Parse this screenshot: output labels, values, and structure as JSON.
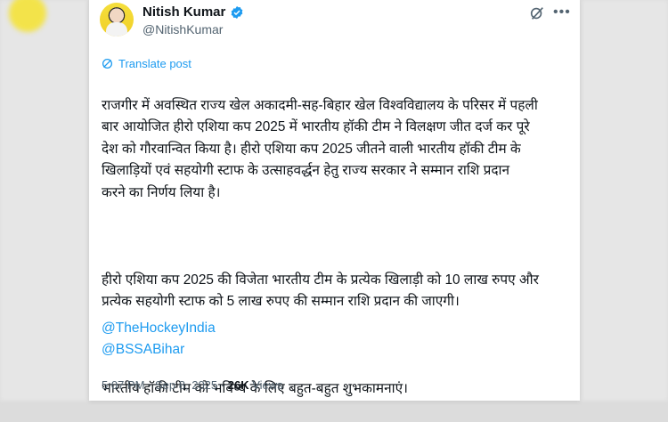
{
  "author": {
    "name": "Nitish Kumar",
    "handle": "@NitishKumar"
  },
  "translate_label": "Translate post",
  "post": {
    "paragraph1": "राजगीर में अवस्थित राज्य खेल अकादमी-सह-बिहार खेल विश्वविद्यालय के परिसर में पहली\nबार आयोजित हीरो एशिया कप 2025 में भारतीय हॉकी टीम ने विलक्षण जीत दर्ज कर पूरे\nदेश को गौरवान्वित किया है। हीरो एशिया कप 2025 जीतने वाली भारतीय हॉकी टीम के\nखिलाड़ियों एवं सहयोगी स्टाफ के उत्साहवर्द्धन हेतु राज्य सरकार ने सम्मान राशि प्रदान\nकरने का निर्णय लिया है।",
    "paragraph2": "हीरो एशिया कप 2025 की विजेता भारतीय टीम के प्रत्येक खिलाड़ी को 10 लाख रुपए और\nप्रत्येक सहयोगी स्टाफ को 5 लाख रुपए की सम्मान राशि प्रदान की जाएगी।",
    "paragraph3": "भारतीय हॉकी टीम को भविष्य के लिए बहुत-बहुत शुभकामनाएं।",
    "mentions": [
      "@TheHockeyIndia",
      "@BSSABihar"
    ]
  },
  "meta": {
    "time": "5:07 PM",
    "separator": "·",
    "date": "Sep 8, 2025",
    "views_count": "26K",
    "views_label": "Views"
  },
  "colors": {
    "link": "#1d9bf0",
    "text": "#0f1419",
    "muted": "#536471",
    "verified": "#1d9bf0"
  },
  "icons": [
    "verified-badge-icon",
    "grok-icon",
    "more-icon",
    "translate-icon"
  ]
}
